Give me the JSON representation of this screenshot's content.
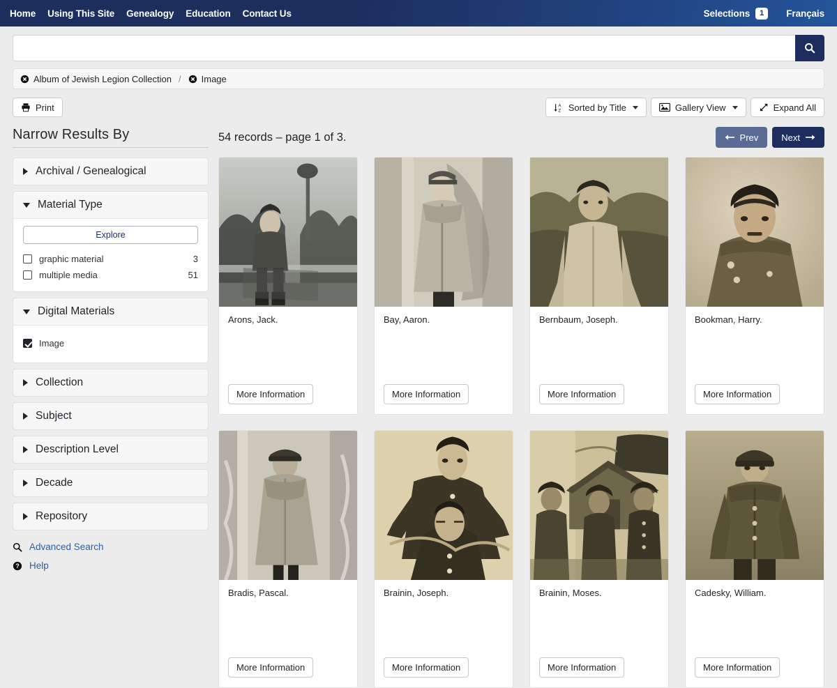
{
  "navbar": {
    "links": [
      "Home",
      "Using This Site",
      "Genealogy",
      "Education",
      "Contact Us"
    ],
    "selections_label": "Selections",
    "selections_count": "1",
    "language_label": "Français",
    "bg_start": "#1d2e5e",
    "bg_end": "#24549a"
  },
  "search": {
    "value": "",
    "placeholder": "",
    "button_icon": "search-icon"
  },
  "filterbar": {
    "chips": [
      {
        "label": "Album of Jewish Legion Collection",
        "icon": "remove-circle-icon"
      },
      {
        "label": "Image",
        "icon": "remove-circle-icon"
      }
    ],
    "separator": "/"
  },
  "toolbar": {
    "print_label": "Print",
    "sort_label": "Sorted by Title",
    "view_label": "Gallery View",
    "expand_label": "Expand All"
  },
  "sidebar": {
    "title": "Narrow Results By",
    "facets": [
      {
        "name": "archival-genealogical",
        "label": "Archival / Genealogical",
        "expanded": false
      },
      {
        "name": "material-type",
        "label": "Material Type",
        "expanded": true,
        "explore_label": "Explore",
        "options": [
          {
            "label": "graphic material",
            "count": "3",
            "checked": false
          },
          {
            "label": "multiple media",
            "count": "51",
            "checked": false
          }
        ]
      },
      {
        "name": "digital-materials",
        "label": "Digital Materials",
        "expanded": true,
        "options": [
          {
            "label": "Image",
            "count": "",
            "checked": true
          }
        ]
      },
      {
        "name": "collection",
        "label": "Collection",
        "expanded": false
      },
      {
        "name": "subject",
        "label": "Subject",
        "expanded": false
      },
      {
        "name": "description-level",
        "label": "Description Level",
        "expanded": false
      },
      {
        "name": "decade",
        "label": "Decade",
        "expanded": false
      },
      {
        "name": "repository",
        "label": "Repository",
        "expanded": false
      }
    ],
    "links": [
      {
        "label": "Advanced Search",
        "icon": "search-icon"
      },
      {
        "label": "Help",
        "icon": "help-circle-icon"
      }
    ]
  },
  "results": {
    "count_text": "54 records – page 1 of 3.",
    "prev_label": "Prev",
    "next_label": "Next",
    "more_info_label": "More Information",
    "cards": [
      {
        "title": "Arons, Jack.",
        "thumb": "seated-soldier-garden-bw"
      },
      {
        "title": "Bay, Aaron.",
        "thumb": "standing-soldier-cape-bw"
      },
      {
        "title": "Bernbaum, Joseph.",
        "thumb": "soldier-outdoors-sepia"
      },
      {
        "title": "Bookman, Harry.",
        "thumb": "portrait-soldier-sepia"
      },
      {
        "title": "Bradis, Pascal.",
        "thumb": "soldier-cape-cap-bw"
      },
      {
        "title": "Brainin, Joseph.",
        "thumb": "two-soldiers-studio-sepia"
      },
      {
        "title": "Brainin, Moses.",
        "thumb": "three-soldiers-hut-sepia"
      },
      {
        "title": "Cadesky, William.",
        "thumb": "soldier-standing-sepia"
      }
    ]
  }
}
